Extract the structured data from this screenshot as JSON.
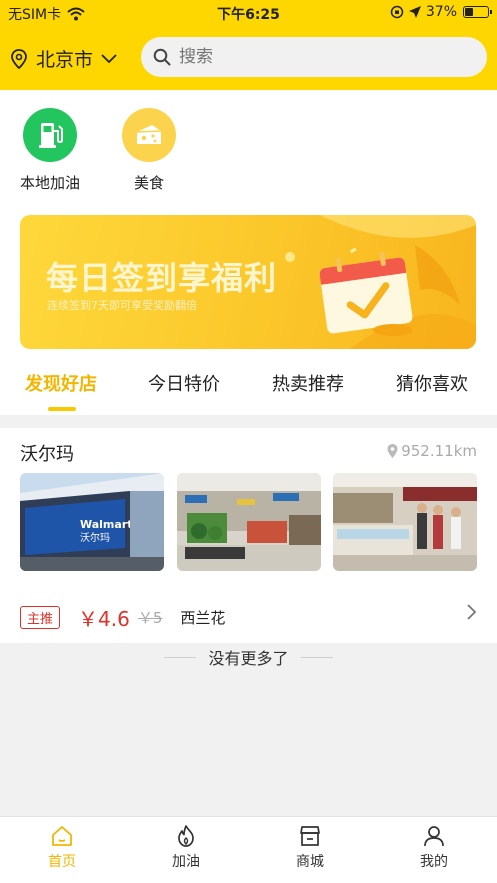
{
  "status_bar": {
    "carrier": "无SIM卡",
    "time": "下午6:25",
    "battery": "37%",
    "battery_level": 0.37
  },
  "header": {
    "city": "北京市",
    "search_placeholder": "搜索"
  },
  "categories": [
    {
      "label": "本地加油",
      "icon": "gas-station-icon",
      "color": "#22c55e"
    },
    {
      "label": "美食",
      "icon": "cheese-icon",
      "color": "#fcd34d"
    }
  ],
  "banner": {
    "title": "每日签到享福利",
    "subtitle": "连续签到7天即可享受奖励翻倍"
  },
  "tabs": [
    {
      "label": "发现好店",
      "active": true
    },
    {
      "label": "今日特价",
      "active": false
    },
    {
      "label": "热卖推荐",
      "active": false
    },
    {
      "label": "猜你喜欢",
      "active": false
    }
  ],
  "store": {
    "name": "沃尔玛",
    "distance": "952.11km",
    "storefront_sign": "Walmart 沃尔玛",
    "promo": {
      "badge": "主推",
      "price": "￥4.6",
      "old_price": "￥5",
      "item": "西兰花"
    }
  },
  "list_end": "没有更多了",
  "tabbar": [
    {
      "label": "首页",
      "icon": "home-icon",
      "active": true
    },
    {
      "label": "加油",
      "icon": "flame-icon",
      "active": false
    },
    {
      "label": "商城",
      "icon": "store-icon",
      "active": false
    },
    {
      "label": "我的",
      "icon": "user-icon",
      "active": false
    }
  ],
  "colors": {
    "brand_yellow": "#fed700",
    "active_yellow": "#f2b600",
    "price_red": "#e0322a"
  }
}
